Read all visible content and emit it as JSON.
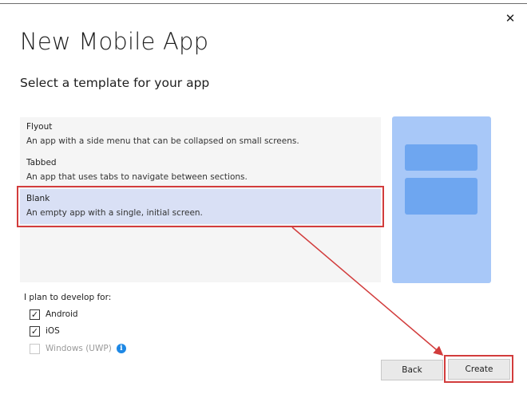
{
  "dialog": {
    "title": "New Mobile App",
    "subtitle": "Select a template for your app",
    "close_glyph": "✕"
  },
  "templates": [
    {
      "name": "Flyout",
      "description": "An app with a side menu that can be collapsed on small screens.",
      "selected": false
    },
    {
      "name": "Tabbed",
      "description": "An app that uses tabs to navigate between sections.",
      "selected": false
    },
    {
      "name": "Blank",
      "description": "An empty app with a single, initial screen.",
      "selected": true
    }
  ],
  "platforms": {
    "label": "I plan to develop for:",
    "items": [
      {
        "label": "Android",
        "checked": true,
        "enabled": true
      },
      {
        "label": "iOS",
        "checked": true,
        "enabled": true
      },
      {
        "label": "Windows (UWP)",
        "checked": false,
        "enabled": false
      }
    ],
    "info_glyph": "i"
  },
  "buttons": {
    "back_label": "Back",
    "create_label": "Create"
  },
  "icons": {
    "close": "close-icon",
    "info": "info-icon",
    "check": "checkmark-icon",
    "annotation_arrow": "arrow-icon"
  },
  "colors": {
    "selection_bg": "#d9e0f5",
    "annotation_red": "#d23c3c",
    "preview_bg": "#a8c8f8",
    "preview_bar": "#6ea6f0",
    "info_blue": "#1e88e5"
  }
}
